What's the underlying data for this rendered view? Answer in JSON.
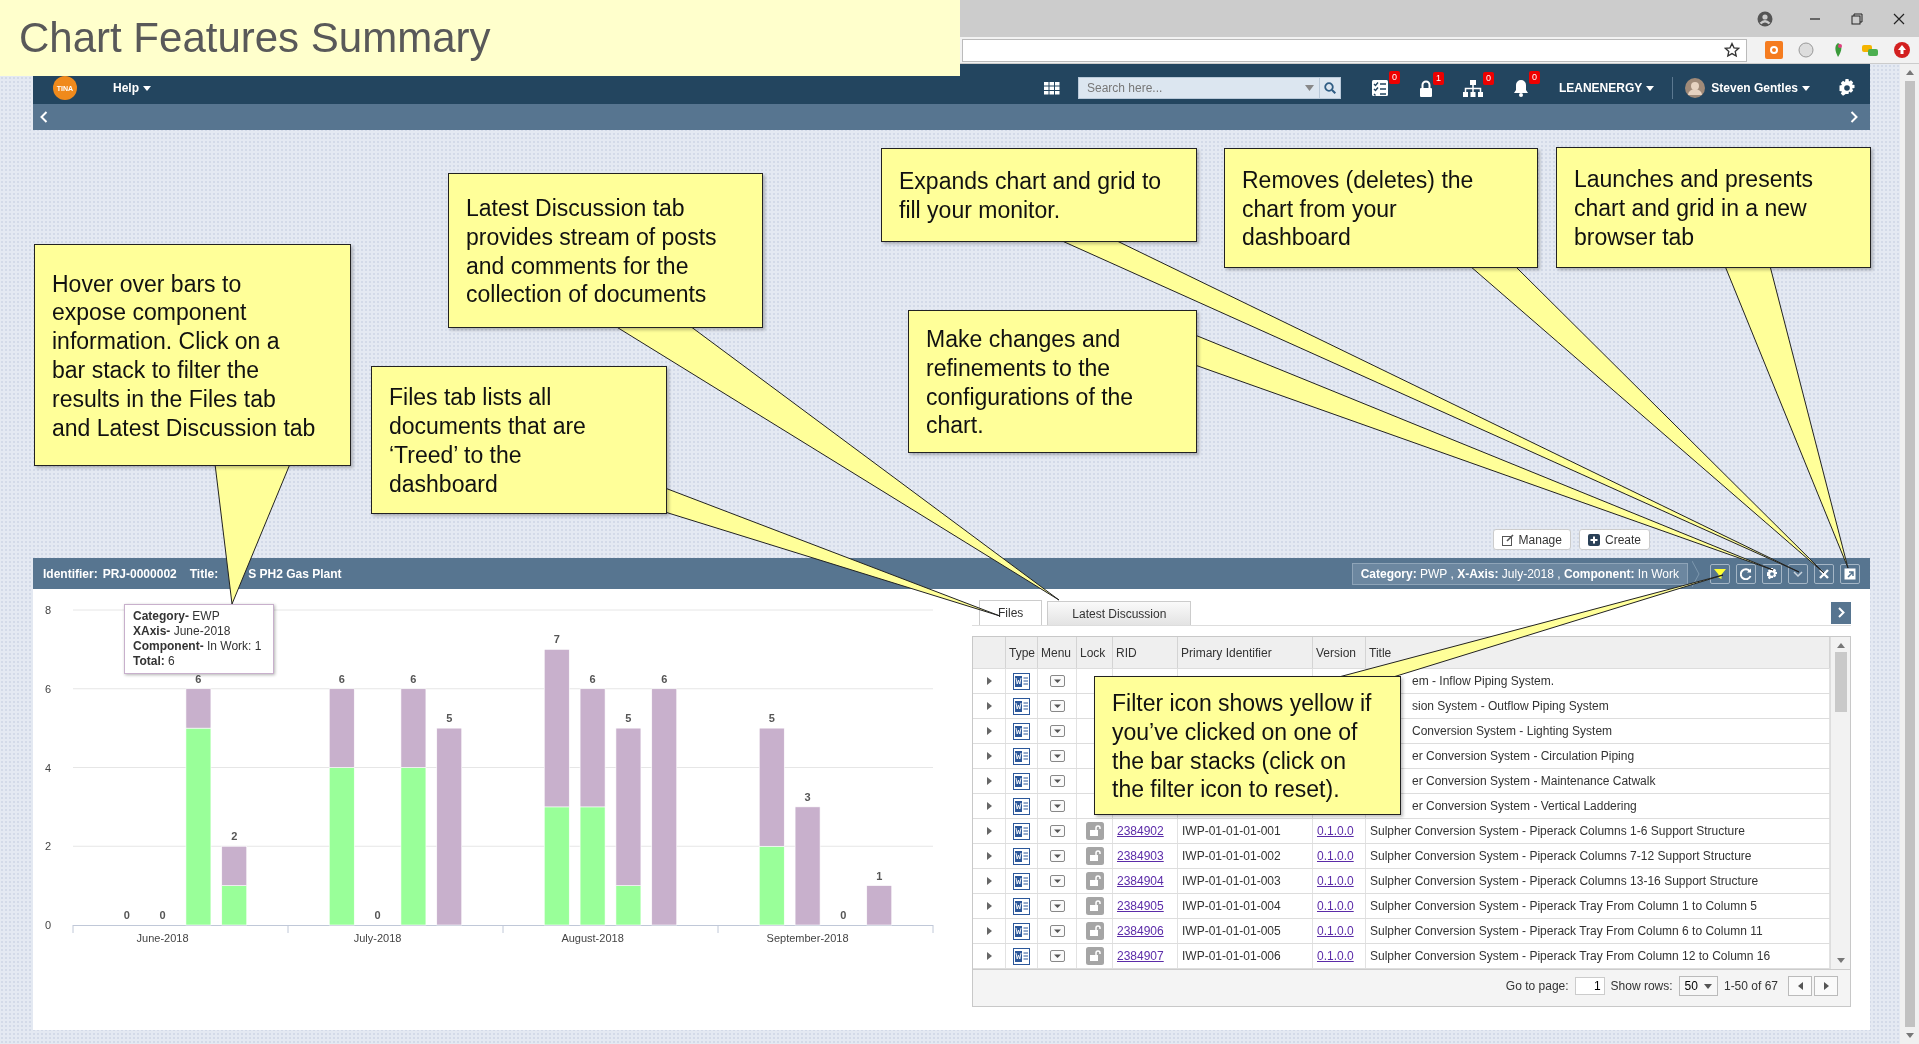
{
  "slide_title": "Chart Features Summary",
  "nav": {
    "logo": "TINA",
    "help": "Help",
    "search": {
      "placeholder": "Search here..."
    },
    "notifications": [
      {
        "kind": "tasks",
        "count": "0"
      },
      {
        "kind": "lock",
        "count": "1"
      },
      {
        "kind": "hierarchy",
        "count": "0"
      },
      {
        "kind": "bell",
        "count": "0"
      }
    ],
    "organization": "LEANENERGY",
    "user": "Steven Gentles"
  },
  "actions": [
    {
      "kind": "edit",
      "label": "Manage"
    },
    {
      "kind": "add",
      "label": "Create"
    }
  ],
  "panel": {
    "identifier_label": "Identifier:",
    "identifier": "PRJ-0000002",
    "title_label": "Title:",
    "title": "S PH2 Gas Plant",
    "filter_summary": "**Category:** PWP , **X-Axis:** July-2018 , **Component:** In Work",
    "filter_active": true,
    "chart": {
      "tooltip": [
        "**Category-** EWP",
        "**XAxis-** June-2018",
        "**Component-** In Work: 1",
        "**Total:** 6"
      ],
      "chart_data": {
        "type": "bar",
        "stacked": true,
        "grid": true,
        "categories": [
          null,
          null,
          "June-2018",
          null,
          null,
          null,
          null,
          null,
          "July-2018",
          null,
          null,
          null,
          null,
          null,
          "August-2018",
          null,
          null,
          null,
          null,
          null,
          "September-2018",
          null,
          null,
          null
        ],
        "ylim": [
          0,
          8
        ],
        "yticks": [
          0,
          2,
          4,
          6,
          8
        ],
        "series": [
          {
            "color": "#99ff99",
            "values": [
              null,
              0,
              0,
              5,
              1,
              null,
              null,
              4,
              0,
              4,
              0,
              null,
              null,
              3,
              3,
              1,
              0,
              null,
              null,
              2,
              0,
              0,
              0,
              null
            ]
          },
          {
            "color": "#c8b0cc",
            "values": [
              null,
              0,
              0,
              1,
              1,
              null,
              null,
              2,
              0,
              2,
              5,
              null,
              null,
              4,
              3,
              4,
              6,
              null,
              null,
              3,
              3,
              0,
              1,
              null
            ]
          }
        ],
        "value_labels": [
          null,
          "0",
          "0",
          "6",
          "2",
          null,
          null,
          "6",
          "0",
          "6",
          "5",
          null,
          null,
          "7",
          "6",
          "5",
          "6",
          null,
          null,
          "5",
          "3",
          "0",
          "1",
          null
        ]
      }
    },
    "tabs": [
      {
        "label": "Files",
        "selected": true
      },
      {
        "label": "Latest Discussion",
        "selected": false
      }
    ],
    "table": {
      "columns": [
        "Type",
        "Menu",
        "Lock",
        "RID",
        "Primary Identifier",
        "Version",
        "Title"
      ],
      "rows": [
        {
          "title": "em - Inflow Piping System."
        },
        {
          "title": "sion System - Outflow Piping System"
        },
        {
          "title": "Conversion System - Lighting System"
        },
        {
          "title": "er Conversion System - Circulation Piping"
        },
        {
          "title": "er Conversion System - Maintenance Catwalk"
        },
        {
          "title": "er Conversion System - Vertical Laddering"
        },
        {
          "rid": "2384902",
          "identifier": "IWP-01-01-01-001",
          "version": "0.1.0.0",
          "title": "Sulpher Conversion System - Piperack Columns 1-6 Support Structure"
        },
        {
          "rid": "2384903",
          "identifier": "IWP-01-01-01-002",
          "version": "0.1.0.0",
          "title": "Sulpher Conversion System - Piperack Columns 7-12 Support Structure"
        },
        {
          "rid": "2384904",
          "identifier": "IWP-01-01-01-003",
          "version": "0.1.0.0",
          "title": "Sulpher Conversion System - Piperack Columns 13-16 Support Structure"
        },
        {
          "rid": "2384905",
          "identifier": "IWP-01-01-01-004",
          "version": "0.1.0.0",
          "title": "Sulpher Conversion System - Piperack Tray From Column 1 to Column 5"
        },
        {
          "rid": "2384906",
          "identifier": "IWP-01-01-01-005",
          "version": "0.1.0.0",
          "title": "Sulpher Conversion System - Piperack Tray From Column 6 to Column 11"
        },
        {
          "rid": "2384907",
          "identifier": "IWP-01-01-01-006",
          "version": "0.1.0.0",
          "title": "Sulpher Conversion System - Piperack Tray From Column 12 to Column 16"
        }
      ],
      "footer": {
        "go_to_page_label": "Go to page:",
        "page": "1",
        "show_rows_label": "Show rows:",
        "rows_per_page": "50",
        "range": "1-50 of 67"
      }
    }
  },
  "callouts": [
    "Latest Discussion tab\nprovides stream of posts\nand comments for the\ncollection of documents",
    "Expands chart and grid to\nfill your monitor.",
    "Removes (deletes) the\nchart from your\ndashboard",
    "Launches and presents\nchart and grid in a new\nbrowser tab",
    "Hover over bars to\nexpose component\ninformation. Click on a\nbar stack to filter the\nresults in the Files tab\nand Latest Discussion tab",
    "Make changes and\nrefinements to the\nconfigurations of the\nchart.",
    "Files tab lists all\ndocuments that are\n‘Treed’ to the\ndashboard",
    "Filter icon shows yellow if\nyou’ve clicked on one of\nthe bar stacks (click on\nthe filter icon to reset)."
  ]
}
